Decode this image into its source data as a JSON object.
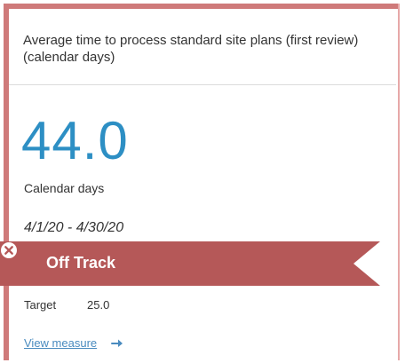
{
  "card": {
    "title": "Average time to process standard site plans (first review)(calendar days)",
    "value": "44.0",
    "unit": "Calendar days",
    "period": "4/1/20 - 4/30/20",
    "status": {
      "label": "Off Track",
      "icon": "x-circle-icon",
      "color": "#b55858"
    },
    "target": {
      "label": "Target",
      "value": "25.0"
    },
    "link": {
      "label": "View measure",
      "icon": "arrow-right-icon"
    }
  },
  "colors": {
    "accent": "#2d8fc4",
    "border": "#cf7a7a",
    "ribbon": "#b55858"
  }
}
